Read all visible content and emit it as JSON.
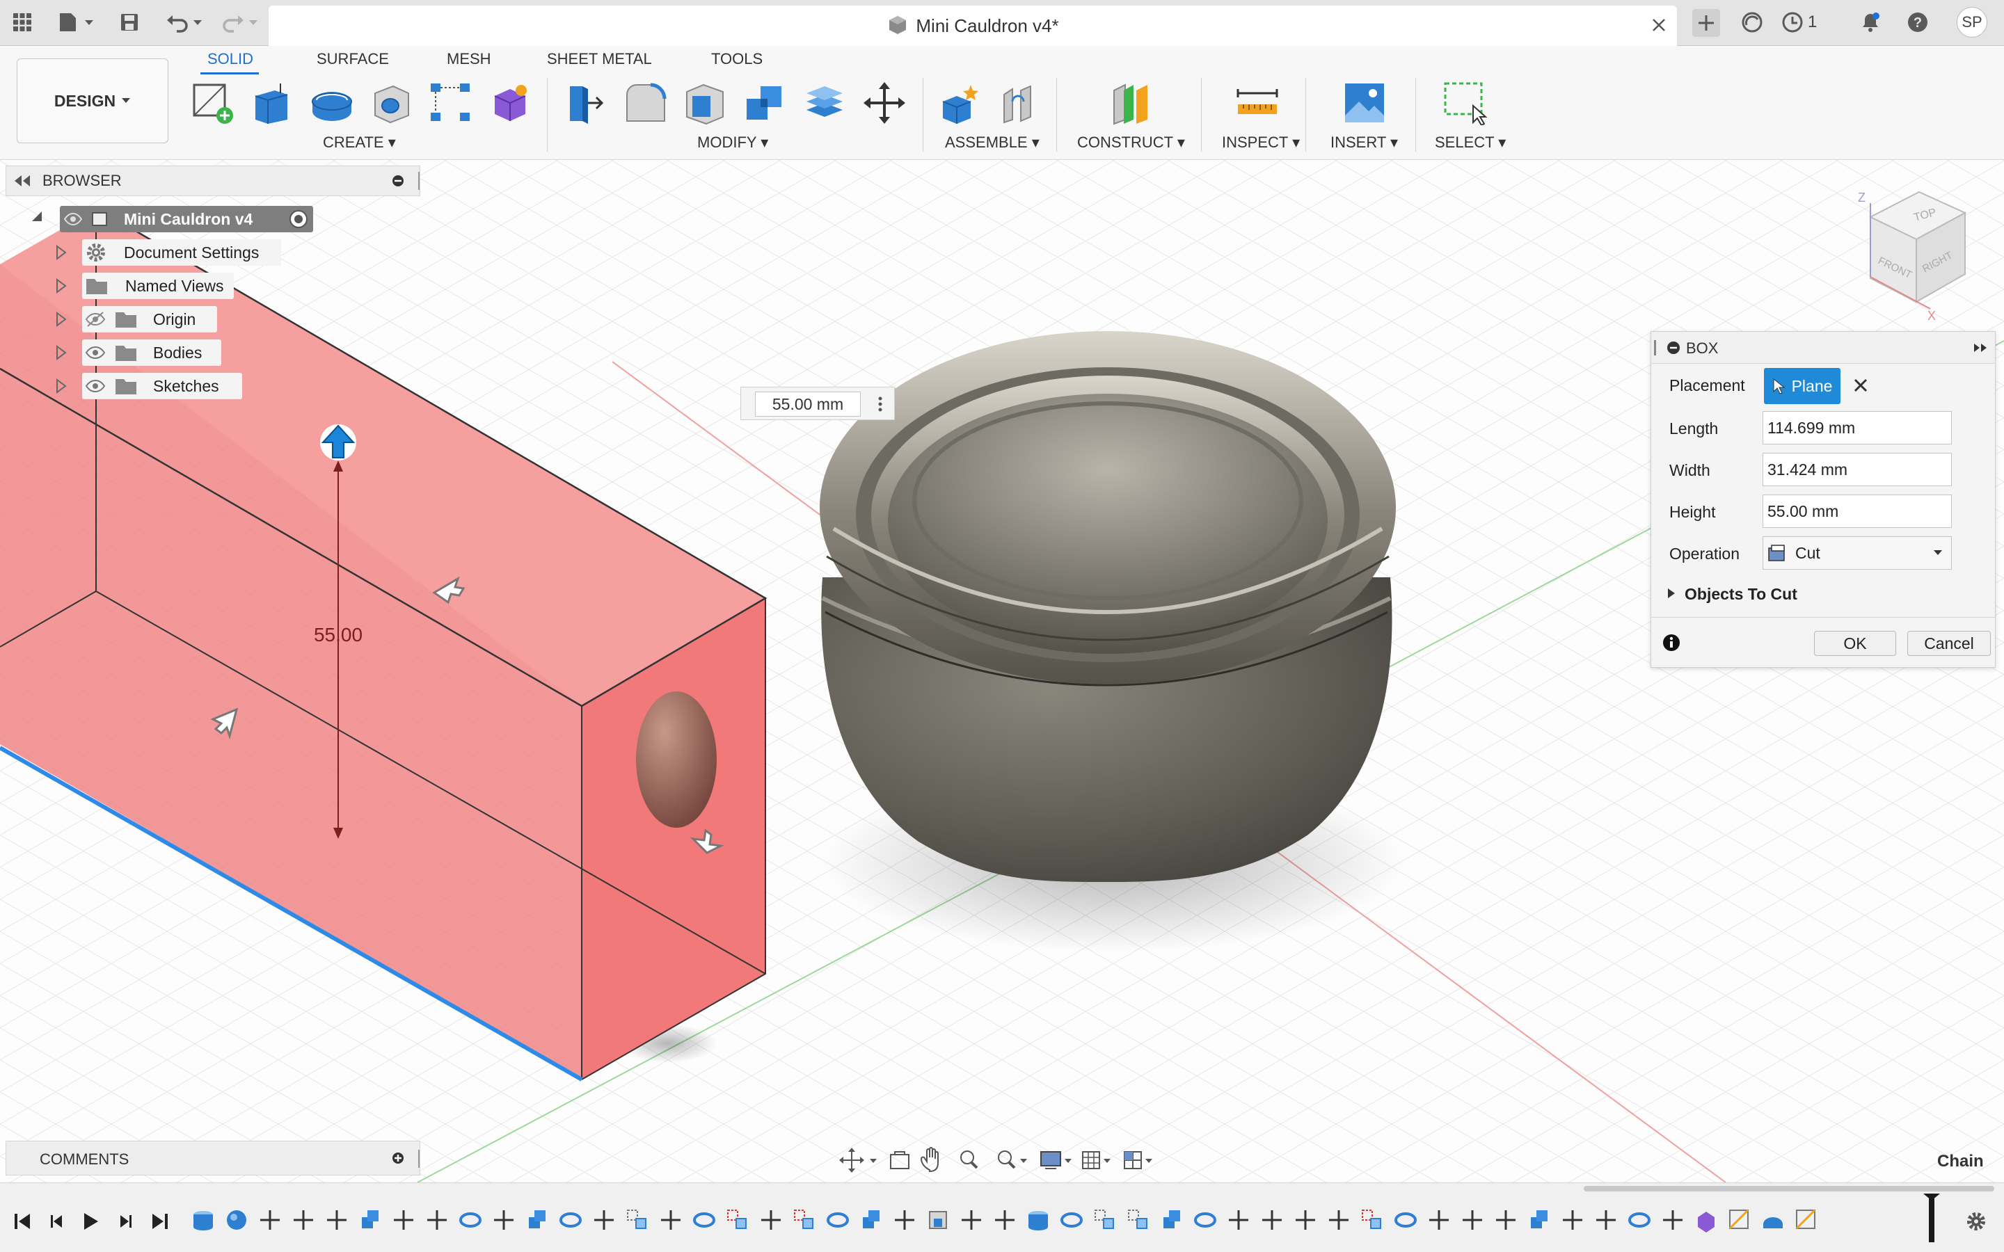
{
  "window": {
    "doc_title": "Mini Cauldron v4*",
    "jobs_count": "1",
    "user_initials": "SP"
  },
  "ribbon": {
    "workspace": "DESIGN",
    "tabs": [
      "SOLID",
      "SURFACE",
      "MESH",
      "SHEET METAL",
      "TOOLS"
    ],
    "active_tab": "SOLID",
    "groups": {
      "create": "CREATE",
      "modify": "MODIFY",
      "assemble": "ASSEMBLE",
      "construct": "CONSTRUCT",
      "inspect": "INSPECT",
      "insert": "INSERT",
      "select": "SELECT"
    }
  },
  "browser": {
    "title": "BROWSER",
    "root": "Mini Cauldron v4",
    "items": [
      {
        "label": "Document Settings",
        "icon": "gear-icon"
      },
      {
        "label": "Named Views",
        "icon": "folder-icon"
      },
      {
        "label": "Origin",
        "icon": "folder-icon",
        "visible": false
      },
      {
        "label": "Bodies",
        "icon": "folder-icon",
        "visible": true
      },
      {
        "label": "Sketches",
        "icon": "folder-icon",
        "visible": true
      }
    ]
  },
  "canvas": {
    "height_input": "55.00 mm",
    "dimension_label": "55.00"
  },
  "dialog": {
    "title": "BOX",
    "placement_label": "Placement",
    "placement_value": "Plane",
    "length_label": "Length",
    "length": "114.699 mm",
    "width_label": "Width",
    "width": "31.424 mm",
    "height_label": "Height",
    "height": "55.00 mm",
    "operation_label": "Operation",
    "operation": "Cut",
    "objects_to_cut": "Objects To Cut",
    "ok": "OK",
    "cancel": "Cancel"
  },
  "comments": {
    "title": "COMMENTS"
  },
  "status": {
    "selection_mode": "Chain"
  },
  "colors": {
    "accent": "#1f6fd4",
    "cut_body": "#f08a8a",
    "cauldron": "#6e6b62",
    "egg": "#8a5d52"
  }
}
